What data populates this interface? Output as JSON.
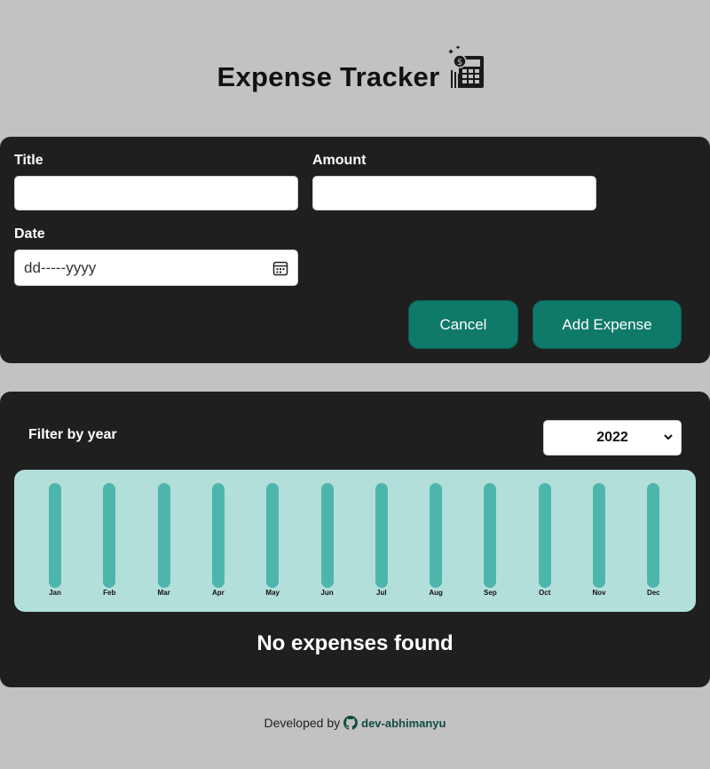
{
  "header": {
    "title": "Expense Tracker",
    "logo_icon": "calculator-money-icon"
  },
  "form": {
    "title_label": "Title",
    "title_value": "",
    "amount_label": "Amount",
    "amount_value": "",
    "date_label": "Date",
    "date_placeholder": "dd-----yyyy",
    "calendar_icon": "calendar-icon",
    "cancel_label": "Cancel",
    "add_label": "Add Expense"
  },
  "filter": {
    "label": "Filter by year",
    "selected_year": "2022"
  },
  "chart_data": {
    "type": "bar",
    "categories": [
      "Jan",
      "Feb",
      "Mar",
      "Apr",
      "May",
      "Jun",
      "Jul",
      "Aug",
      "Sep",
      "Oct",
      "Nov",
      "Dec"
    ],
    "values": [
      0,
      0,
      0,
      0,
      0,
      0,
      0,
      0,
      0,
      0,
      0,
      0
    ],
    "title": "",
    "xlabel": "",
    "ylabel": ""
  },
  "empty_message": "No expenses found",
  "footer": {
    "prefix": "Developed by",
    "github_icon": "github-icon",
    "author": "dev-abhimanyu"
  },
  "colors": {
    "page_bg": "#c3c1c2",
    "card_bg": "#1f1f1f",
    "accent": "#0f7a6a",
    "chart_bg": "#b3dfdb",
    "bar_track": "#4db6ac"
  }
}
